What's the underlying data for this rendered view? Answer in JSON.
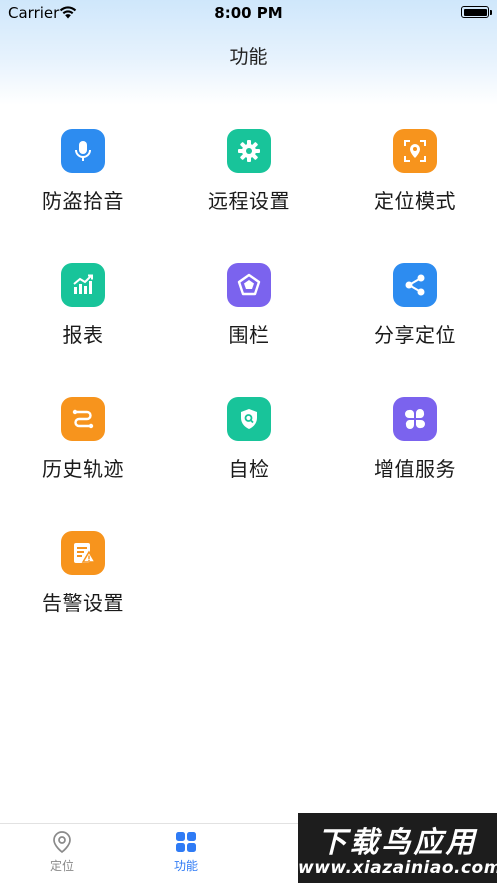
{
  "status_bar": {
    "carrier": "Carrier",
    "time": "8:00 PM"
  },
  "header": {
    "title": "功能"
  },
  "functions": [
    {
      "label": "防盗拾音",
      "icon": "microphone-icon",
      "color": "#2d8cf0"
    },
    {
      "label": "远程设置",
      "icon": "gear-icon",
      "color": "#18c49a"
    },
    {
      "label": "定位模式",
      "icon": "location-scan-icon",
      "color": "#f7941d"
    },
    {
      "label": "报表",
      "icon": "chart-icon",
      "color": "#18c49a"
    },
    {
      "label": "围栏",
      "icon": "pentagon-fence-icon",
      "color": "#7b63ee"
    },
    {
      "label": "分享定位",
      "icon": "share-icon",
      "color": "#2d8cf0"
    },
    {
      "label": "历史轨迹",
      "icon": "track-path-icon",
      "color": "#f7941d"
    },
    {
      "label": "自检",
      "icon": "shield-search-icon",
      "color": "#18c49a"
    },
    {
      "label": "增值服务",
      "icon": "grid-petals-icon",
      "color": "#7b63ee"
    },
    {
      "label": "告警设置",
      "icon": "alarm-doc-icon",
      "color": "#f7941d"
    }
  ],
  "tabbar": {
    "tabs": [
      {
        "label": "定位",
        "icon": "location-pin-icon",
        "active": false
      },
      {
        "label": "功能",
        "icon": "grid-icon",
        "active": true
      }
    ],
    "active_color": "#2f7bf5",
    "inactive_color": "#8a8a8a"
  },
  "watermark": {
    "top": "下载鸟应用",
    "bottom": "www.xiazainiao.com"
  }
}
